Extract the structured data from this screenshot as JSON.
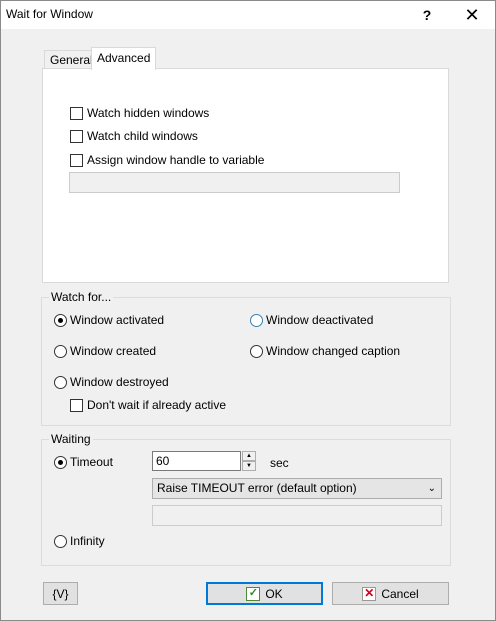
{
  "window": {
    "title": "Wait for Window",
    "help_label": "?",
    "close_label": "✕"
  },
  "tabs": [
    {
      "label": "General"
    },
    {
      "label": "Advanced"
    }
  ],
  "advanced": {
    "watch_hidden": "Watch hidden windows",
    "watch_child": "Watch child windows",
    "assign_handle": "Assign window handle to variable",
    "handle_value": ""
  },
  "watch_for": {
    "label": "Watch for...",
    "activated": "Window activated",
    "deactivated": "Window deactivated",
    "created": "Window created",
    "changed_caption": "Window changed caption",
    "destroyed": "Window destroyed",
    "dont_wait": "Don't wait if already active",
    "selected": "activated"
  },
  "waiting": {
    "label": "Waiting",
    "timeout_label": "Timeout",
    "timeout_value": "60",
    "unit": "sec",
    "error_option": "Raise TIMEOUT error (default option)",
    "extra_value": "",
    "infinity_label": "Infinity",
    "selected": "timeout"
  },
  "buttons": {
    "variables": "{V}",
    "ok": "OK",
    "cancel": "Cancel"
  },
  "colors": {
    "accent": "#0078d7",
    "ok_check": "#2e8b2e",
    "cancel_x": "#d0021b"
  }
}
